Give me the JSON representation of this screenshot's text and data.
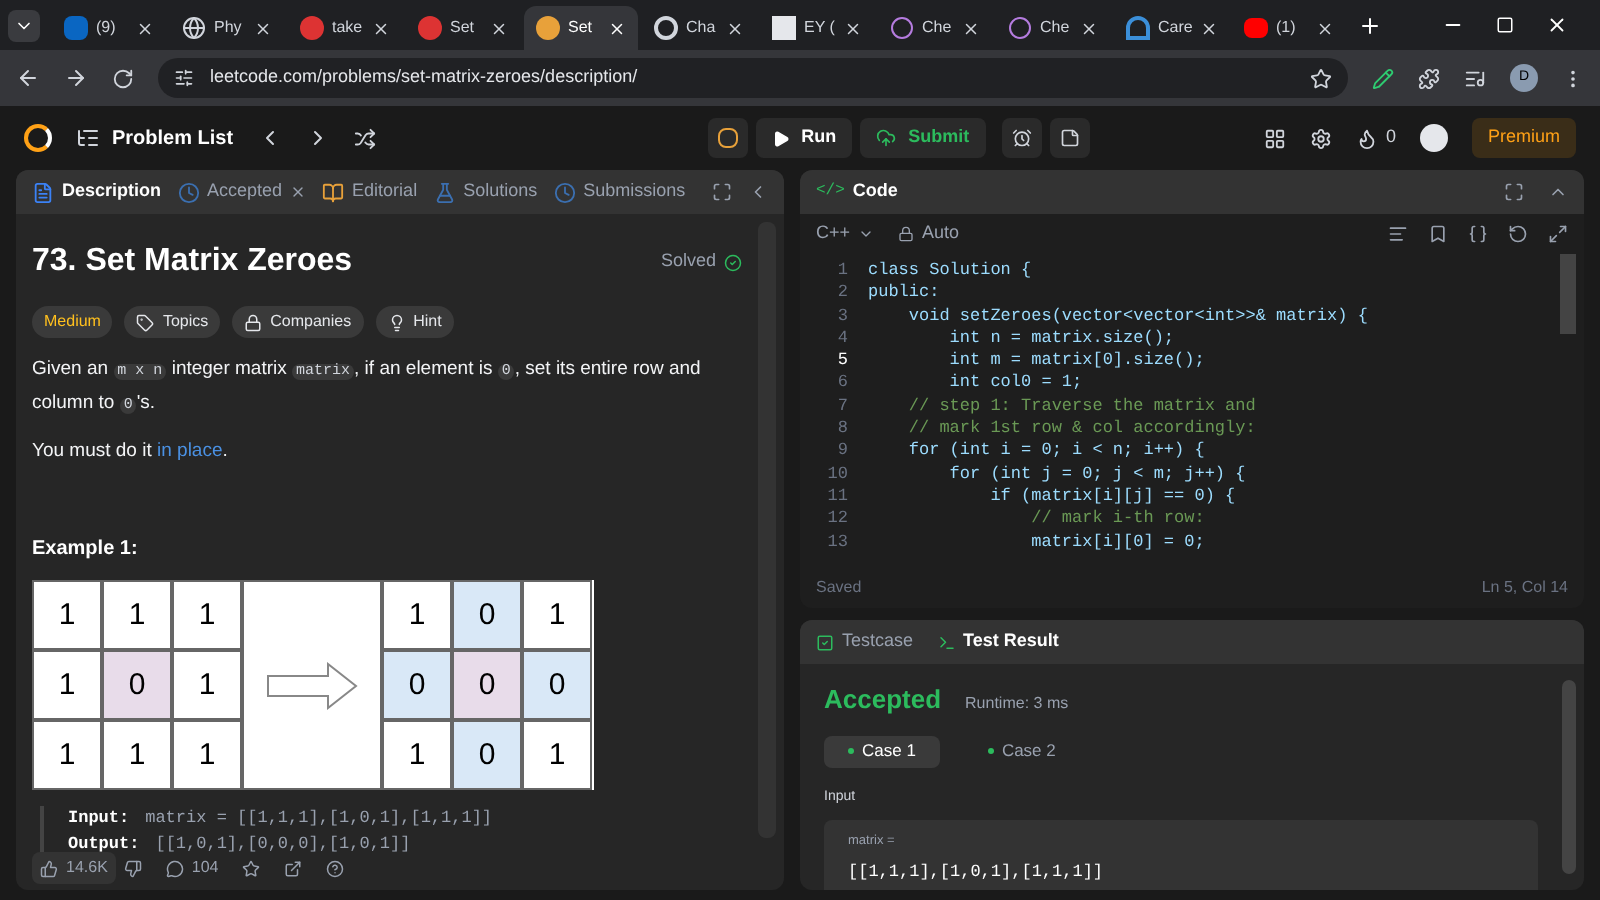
{
  "browser": {
    "tabs": [
      {
        "label": "(9)",
        "selected": false
      },
      {
        "label": "Phy",
        "selected": false
      },
      {
        "label": "take",
        "selected": false
      },
      {
        "label": "Set",
        "selected": false
      },
      {
        "label": "Set",
        "selected": true
      },
      {
        "label": "Cha",
        "selected": false
      },
      {
        "label": "EY (",
        "selected": false
      },
      {
        "label": "Che",
        "selected": false
      },
      {
        "label": "Che",
        "selected": false
      },
      {
        "label": "Care",
        "selected": false
      },
      {
        "label": "(1)",
        "selected": false
      }
    ],
    "url": "leetcode.com/problems/set-matrix-zeroes/description/",
    "profile": "D"
  },
  "nav": {
    "problem_list": "Problem List",
    "run": "Run",
    "submit": "Submit",
    "streak": "0",
    "premium": "Premium"
  },
  "left": {
    "tabs": [
      {
        "label": "Description",
        "selected": true,
        "closable": false
      },
      {
        "label": "Accepted",
        "selected": false,
        "closable": true
      },
      {
        "label": "Editorial",
        "selected": false,
        "closable": false
      },
      {
        "label": "Solutions",
        "selected": false,
        "closable": false
      },
      {
        "label": "Submissions",
        "selected": false,
        "closable": false
      }
    ],
    "title": "73. Set Matrix Zeroes",
    "status": "Solved",
    "tags": [
      {
        "label": "Medium",
        "kind": "difficulty"
      },
      {
        "label": "Topics",
        "kind": "tag"
      },
      {
        "label": "Companies",
        "kind": "lock"
      },
      {
        "label": "Hint",
        "kind": "bulb"
      }
    ],
    "statement": [
      {
        "kind": "text",
        "t": "Given an "
      },
      {
        "kind": "code",
        "t": "m x n"
      },
      {
        "kind": "text",
        "t": " integer matrix "
      },
      {
        "kind": "code",
        "t": "matrix"
      },
      {
        "kind": "text",
        "t": ", if an element is "
      },
      {
        "kind": "code",
        "t": "0"
      },
      {
        "kind": "text",
        "t": ", set its entire row and column to "
      },
      {
        "kind": "code",
        "t": "0"
      },
      {
        "kind": "text",
        "t": "'s."
      }
    ],
    "inplace": {
      "before": "You must do it ",
      "link": "in place",
      "after": "."
    },
    "example_title": "Example 1:",
    "grid_in": [
      [
        {
          "v": "1",
          "color": "#ffffff"
        },
        {
          "v": "1",
          "color": "#ffffff"
        },
        {
          "v": "1",
          "color": "#ffffff"
        }
      ],
      [
        {
          "v": "1",
          "color": "#ffffff"
        },
        {
          "v": "0",
          "color": "#e8dcea"
        },
        {
          "v": "1",
          "color": "#ffffff"
        }
      ],
      [
        {
          "v": "1",
          "color": "#ffffff"
        },
        {
          "v": "1",
          "color": "#ffffff"
        },
        {
          "v": "1",
          "color": "#ffffff"
        }
      ]
    ],
    "grid_out": [
      [
        {
          "v": "1",
          "color": "#ffffff"
        },
        {
          "v": "0",
          "color": "#d9e8f7"
        },
        {
          "v": "1",
          "color": "#ffffff"
        }
      ],
      [
        {
          "v": "0",
          "color": "#d9e8f7"
        },
        {
          "v": "0",
          "color": "#e8dcea"
        },
        {
          "v": "0",
          "color": "#d9e8f7"
        }
      ],
      [
        {
          "v": "1",
          "color": "#ffffff"
        },
        {
          "v": "0",
          "color": "#d9e8f7"
        },
        {
          "v": "1",
          "color": "#ffffff"
        }
      ]
    ],
    "io": [
      {
        "label": "Input:",
        "value": "matrix = [[1,1,1],[1,0,1],[1,1,1]]"
      },
      {
        "label": "Output:",
        "value": "[[1,0,1],[0,0,0],[1,0,1]]"
      }
    ],
    "likes": "14.6K",
    "comments": "104"
  },
  "code": {
    "icon_text": "</>",
    "title": "Code",
    "language": "C++",
    "mode": "Auto",
    "lines": [
      {
        "n": "1",
        "kind": "code",
        "current": false,
        "t": "class Solution {"
      },
      {
        "n": "2",
        "kind": "code",
        "current": false,
        "t": "public:"
      },
      {
        "n": "3",
        "kind": "code",
        "current": false,
        "t": "    void setZeroes(vector<vector<int>>& matrix) {"
      },
      {
        "n": "4",
        "kind": "code",
        "current": false,
        "t": "        int n = matrix.size();"
      },
      {
        "n": "5",
        "kind": "code",
        "current": true,
        "t": "        int m = matrix[0].size();"
      },
      {
        "n": "6",
        "kind": "code",
        "current": false,
        "t": "        int col0 = 1;"
      },
      {
        "n": "7",
        "kind": "comment",
        "current": false,
        "t": "    // step 1: Traverse the matrix and"
      },
      {
        "n": "8",
        "kind": "comment",
        "current": false,
        "t": "    // mark 1st row & col accordingly:"
      },
      {
        "n": "9",
        "kind": "code",
        "current": false,
        "t": "    for (int i = 0; i < n; i++) {"
      },
      {
        "n": "10",
        "kind": "code",
        "current": false,
        "t": "        for (int j = 0; j < m; j++) {"
      },
      {
        "n": "11",
        "kind": "code",
        "current": false,
        "t": "            if (matrix[i][j] == 0) {"
      },
      {
        "n": "12",
        "kind": "comment",
        "current": false,
        "t": "                // mark i-th row:"
      },
      {
        "n": "13",
        "kind": "code",
        "current": false,
        "t": "                matrix[i][0] = 0;"
      }
    ],
    "saved": "Saved",
    "position": "Ln 5, Col 14"
  },
  "result": {
    "tabs": [
      {
        "label": "Testcase",
        "selected": false
      },
      {
        "label": "Test Result",
        "selected": true
      }
    ],
    "verdict": "Accepted",
    "runtime": "Runtime: 3 ms",
    "cases": [
      {
        "label": "Case 1",
        "selected": true
      },
      {
        "label": "Case 2",
        "selected": false
      }
    ],
    "input_label": "Input",
    "var": "matrix =",
    "value": "[[1,1,1],[1,0,1],[1,1,1]]"
  }
}
